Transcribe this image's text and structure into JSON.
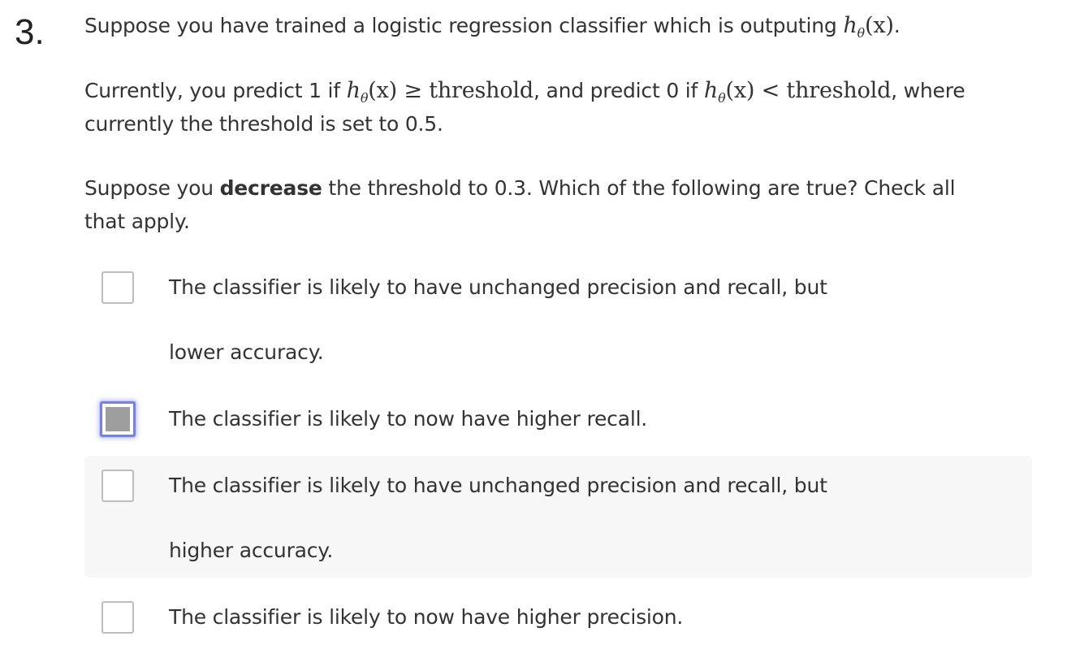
{
  "question": {
    "number": "3.",
    "intro_before": "Suppose you have trained a logistic regression classifier which is outputing ",
    "intro_after": ".",
    "hypothesis_h": "h",
    "hypothesis_sub": "θ",
    "hypothesis_arg": "(x)",
    "line2_a": "Currently, you predict 1 if ",
    "geq": " ≥ ",
    "threshold_word": "threshold",
    "line2_b": ", and predict 0 if ",
    "lt": " < ",
    "line2_c": ", where",
    "line3": "currently the threshold is set to 0.5.",
    "line4_a": "Suppose you ",
    "line4_bold": "decrease",
    "line4_b": " the threshold to 0.3. Which of the following are true? Check all",
    "line5": "that apply."
  },
  "options": [
    {
      "line1": "The classifier is likely to have unchanged precision and recall, but",
      "line2": "lower accuracy.",
      "checked": false
    },
    {
      "line1": "The classifier is likely to now have higher recall.",
      "line2": "",
      "checked": true
    },
    {
      "line1": "The classifier is likely to have unchanged precision and recall, but",
      "line2": "higher accuracy.",
      "checked": false
    },
    {
      "line1": "The classifier is likely to now have higher precision.",
      "line2": "",
      "checked": false
    }
  ],
  "colors": {
    "text": "#333333",
    "checkbox_border": "#bdbdbd",
    "checked_focus_ring": "#7b7fe0",
    "checked_fill": "#9e9e9e",
    "hover_row_bg": "#f7f7f7"
  }
}
